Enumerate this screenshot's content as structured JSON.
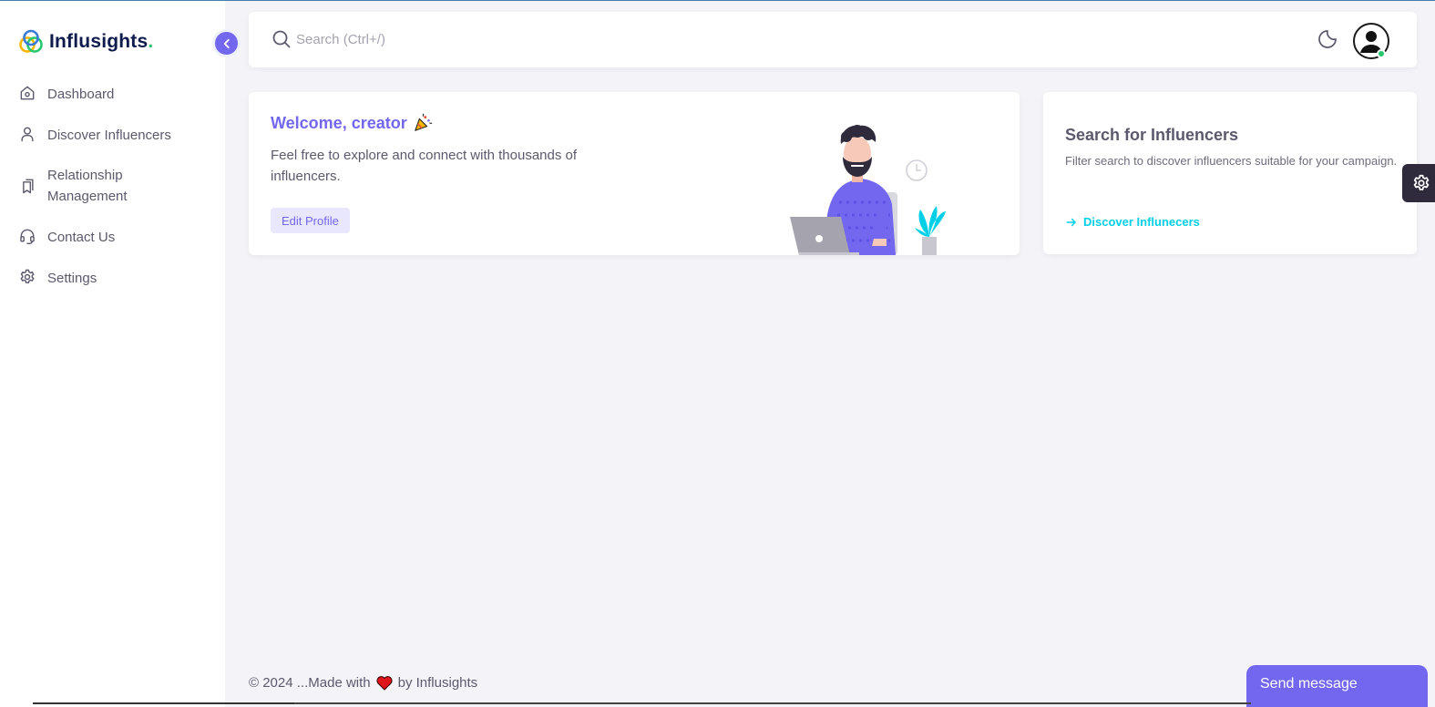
{
  "brand": {
    "name": "Influsights",
    "dot": ".",
    "logo_icon": "rings-logo-icon"
  },
  "sidebar": {
    "collapse_icon": "chevron-left-icon",
    "items": [
      {
        "label": "Dashboard",
        "icon": "home-icon"
      },
      {
        "label": "Discover Influencers",
        "icon": "user-icon"
      },
      {
        "label": "Relationship Management",
        "icon": "bookmarks-icon"
      },
      {
        "label": "Contact Us",
        "icon": "headset-icon"
      },
      {
        "label": "Settings",
        "icon": "gear-icon"
      }
    ]
  },
  "topbar": {
    "search_placeholder": "Search (Ctrl+/)",
    "theme_icon": "moon-icon",
    "avatar_icon": "user-circle-icon"
  },
  "welcome": {
    "title": "Welcome, creator",
    "emoji_icon": "party-popper-icon",
    "text": "Feel free to explore and connect with thousands of influencers.",
    "button": "Edit Profile"
  },
  "search_card": {
    "title": "Search for Influencers",
    "text": "Filter search to discover influencers suitable for your campaign.",
    "link": "Discover Influnecers"
  },
  "footer": {
    "prefix": "© 2024 ...Made with",
    "suffix": "by Influsights"
  },
  "chat": {
    "button": "Send message"
  },
  "colors": {
    "primary": "#7367f0",
    "info": "#00cfe8",
    "success": "#28c76f",
    "background": "#f4f4f8"
  }
}
